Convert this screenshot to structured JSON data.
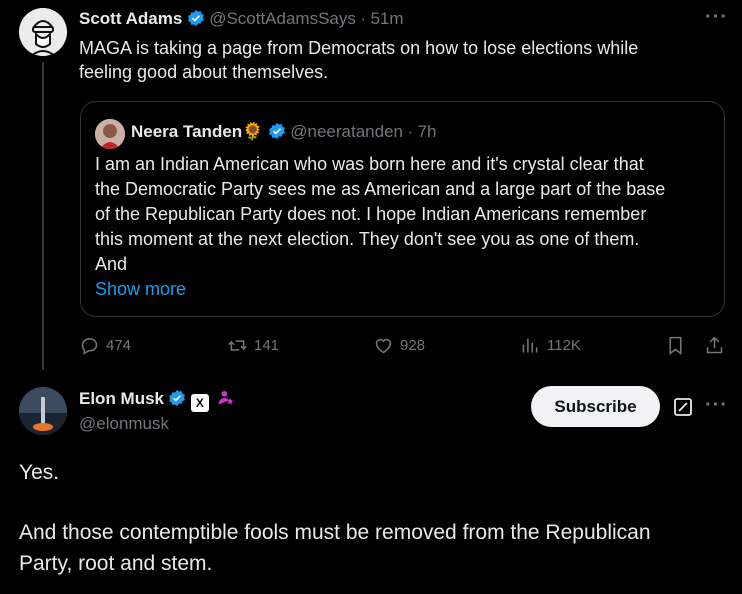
{
  "quoting_tweet": {
    "author_name": "Scott Adams",
    "author_handle": "@ScottAdamsSays",
    "time": "51m",
    "separator": "·",
    "text_lines": [
      "MAGA is taking a page from Democrats on how to lose elections while",
      "feeling good about themselves."
    ],
    "more_icon": "more-icon"
  },
  "quoted_tweet": {
    "author_name": "Neera Tanden",
    "emoji": "🌻",
    "author_handle": "@neeratanden",
    "time": "7h",
    "separator": "·",
    "text_lines": [
      "I am an Indian American who was born here and it's crystal clear that",
      "the Democratic Party sees me as American and a large part of the base",
      "of the Republican Party does not. I hope Indian Americans remember",
      "this moment at the next election. They don't see you as one of them.",
      "And"
    ],
    "show_more": "Show more"
  },
  "actions": {
    "replies": "474",
    "reposts": "141",
    "likes": "928",
    "views": "112K"
  },
  "reply_tweet": {
    "author_name": "Elon Musk",
    "author_handle": "@elonmusk",
    "affiliate_badge": "X",
    "subscribe_label": "Subscribe",
    "text_lines": [
      "Yes.",
      "",
      "And those contemptible fools must be removed from the Republican",
      "Party, root and stem."
    ]
  },
  "colors": {
    "background": "#000000",
    "accent_blue": "#1d9bf0",
    "muted": "#71767b",
    "verified": "#1d9bf0",
    "subscriber_pink": "#c936cc"
  }
}
